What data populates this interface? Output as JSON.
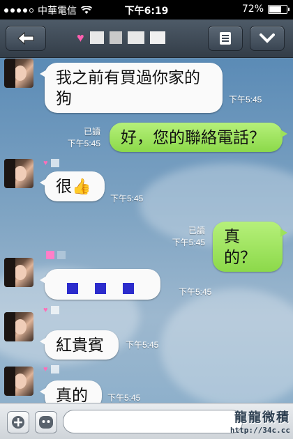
{
  "status_bar": {
    "carrier": "中華電信",
    "time": "下午6:19",
    "battery": "72%",
    "battery_level": 0.72
  },
  "header": {
    "back_icon": "back-arrow-icon",
    "menu_icon": "list-menu-icon",
    "dropdown_icon": "chevron-down-icon",
    "heart_color": "#ff5fb0"
  },
  "messages": [
    {
      "side": "in",
      "text_line1": "我之前有買過你家的",
      "text_line2": "狗",
      "time": "下午5:45"
    },
    {
      "side": "out",
      "text": "好，您的聯絡電話？",
      "read": "已讀",
      "time": "下午5:45"
    },
    {
      "side": "in",
      "text": "很",
      "emoji": "👍",
      "time": "下午5:45"
    },
    {
      "side": "out",
      "text": "真的？",
      "read": "已讀",
      "time": "下午5:45"
    },
    {
      "side": "in",
      "text": "",
      "time": "下午5:45"
    },
    {
      "side": "in",
      "text": "紅貴賓",
      "time": "下午5:45"
    },
    {
      "side": "in",
      "text": "真的",
      "time": "下午5:45"
    }
  ],
  "input_bar": {
    "plus_icon": "plus-icon",
    "sticker_icon": "smiley-icon",
    "placeholder": ""
  },
  "watermark": {
    "text": "龍龍微積",
    "url": "http://34c.cc"
  },
  "colors": {
    "outgoing_bubble": "#9ee25a",
    "incoming_bubble": "#fafafa",
    "header": "#3b4653"
  }
}
